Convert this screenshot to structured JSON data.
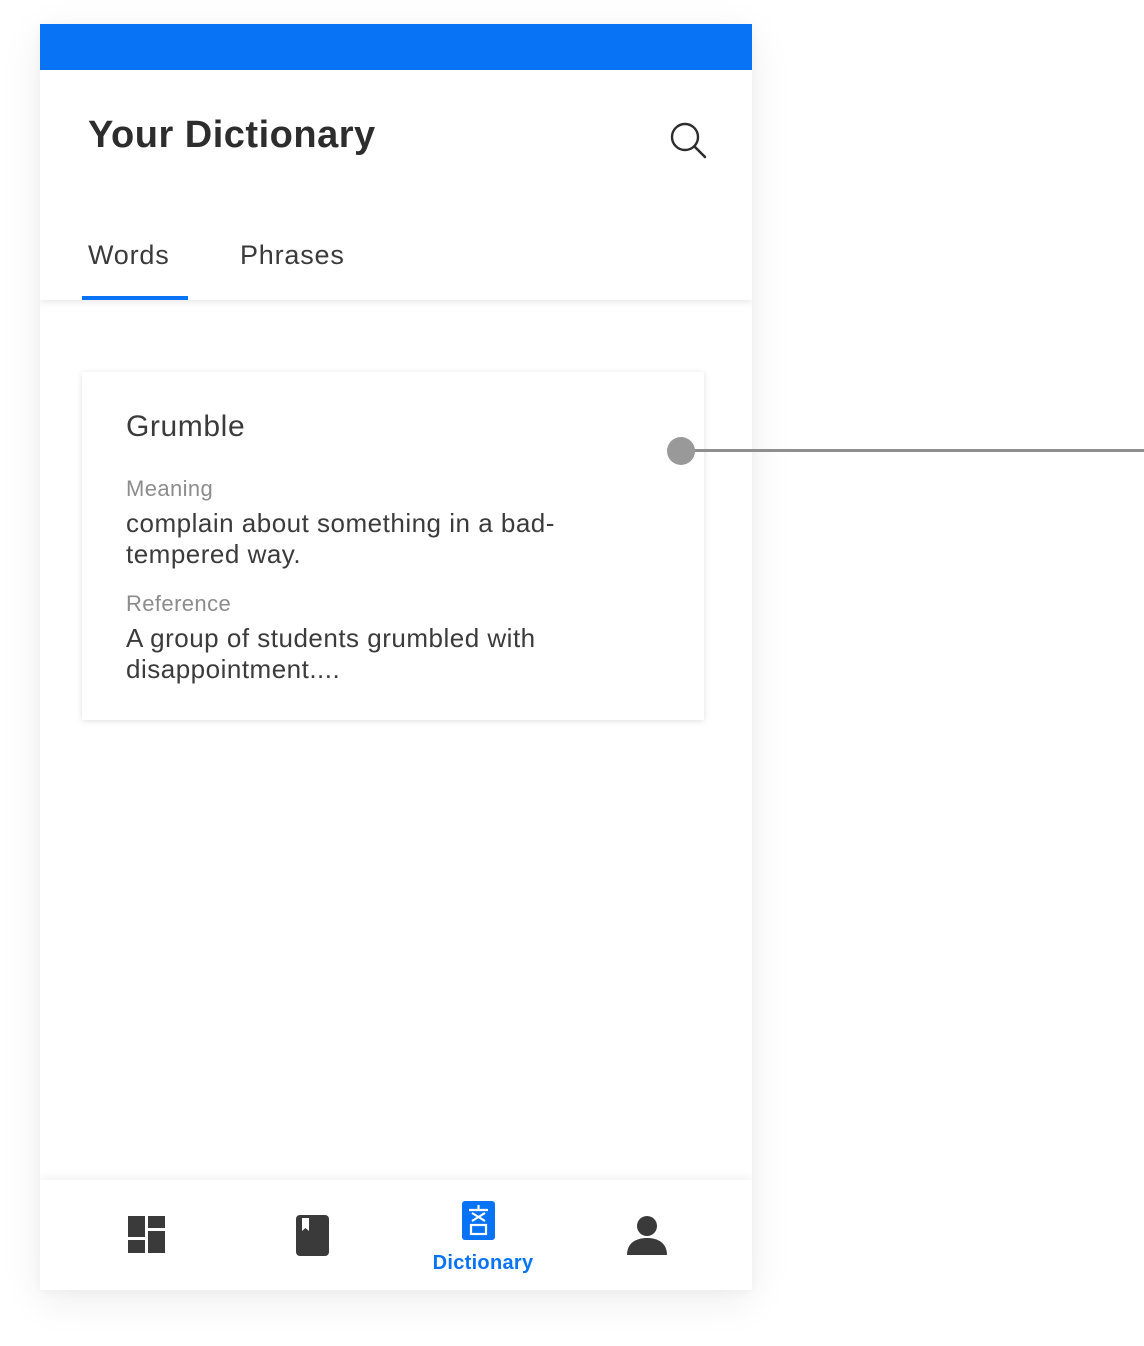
{
  "theme": {
    "accent": "#0873f4",
    "text_primary": "#3b3b3b",
    "text_secondary": "#8c8c8c",
    "icon_color": "#3a3a3a"
  },
  "header": {
    "title": "Your Dictionary",
    "search_icon": "search-icon"
  },
  "tabs": [
    {
      "label": "Words",
      "active": true
    },
    {
      "label": "Phrases",
      "active": false
    }
  ],
  "card": {
    "word": "Grumble",
    "meaning_label": "Meaning",
    "meaning": "complain about something in a bad-tempered way.",
    "reference_label": "Reference",
    "reference": "A group of students grumbled with disappointment...."
  },
  "bottom_nav": {
    "items": [
      {
        "icon": "dashboard-icon",
        "label": "",
        "active": false
      },
      {
        "icon": "book-icon",
        "label": "",
        "active": false
      },
      {
        "icon": "translate-icon",
        "label": "Dictionary",
        "active": true
      },
      {
        "icon": "person-icon",
        "label": "",
        "active": false
      }
    ]
  }
}
